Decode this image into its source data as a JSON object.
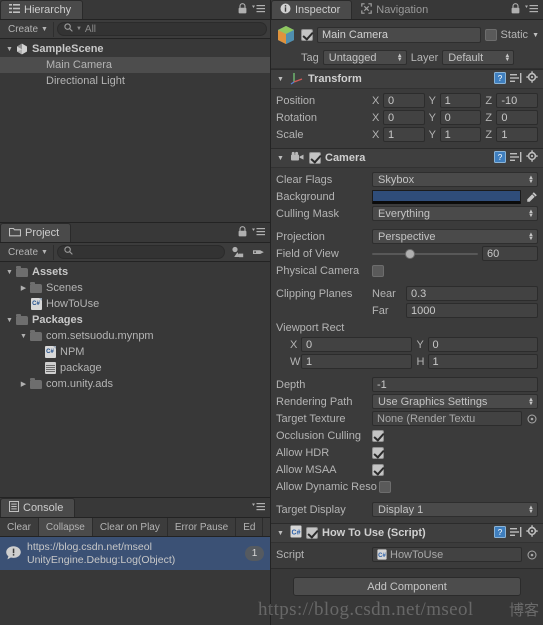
{
  "hierarchy": {
    "tab_label": "Hierarchy",
    "create_label": "Create",
    "search_placeholder": "All",
    "items": [
      {
        "label": "SampleScene",
        "indent": 0,
        "arrow": "down",
        "icon": "unity-scene-icon",
        "bold": true,
        "selected": false
      },
      {
        "label": "Main Camera",
        "indent": 1,
        "arrow": "none",
        "icon": "none",
        "bold": false,
        "selected": true
      },
      {
        "label": "Directional Light",
        "indent": 1,
        "arrow": "none",
        "icon": "none",
        "bold": false,
        "selected": false
      }
    ]
  },
  "project": {
    "tab_label": "Project",
    "create_label": "Create",
    "search_placeholder": "",
    "items": [
      {
        "label": "Assets",
        "indent": 0,
        "arrow": "down",
        "icon": "folder-icon",
        "bold": true
      },
      {
        "label": "Scenes",
        "indent": 1,
        "arrow": "right",
        "icon": "folder-icon",
        "bold": false
      },
      {
        "label": "HowToUse",
        "indent": 1,
        "arrow": "none",
        "icon": "csharp-icon",
        "bold": false
      },
      {
        "label": "Packages",
        "indent": 0,
        "arrow": "down",
        "icon": "folder-icon",
        "bold": true
      },
      {
        "label": "com.setsuodu.mynpm",
        "indent": 1,
        "arrow": "down",
        "icon": "folder-icon",
        "bold": false
      },
      {
        "label": "NPM",
        "indent": 2,
        "arrow": "none",
        "icon": "csharp-icon",
        "bold": false
      },
      {
        "label": "package",
        "indent": 2,
        "arrow": "none",
        "icon": "text-file-icon",
        "bold": false
      },
      {
        "label": "com.unity.ads",
        "indent": 1,
        "arrow": "right",
        "icon": "folder-icon",
        "bold": false
      }
    ]
  },
  "console": {
    "tab_label": "Console",
    "buttons": [
      {
        "label": "Clear",
        "pressed": false
      },
      {
        "label": "Collapse",
        "pressed": true
      },
      {
        "label": "Clear on Play",
        "pressed": false
      },
      {
        "label": "Error Pause",
        "pressed": false
      },
      {
        "label": "Ed",
        "pressed": false
      }
    ],
    "entries": [
      {
        "line1": "https://blog.csdn.net/mseol",
        "line2": "UnityEngine.Debug:Log(Object)",
        "count": "1",
        "selected": true
      }
    ]
  },
  "inspector": {
    "tabs": [
      {
        "label": "Inspector",
        "icon": "info-icon",
        "active": true
      },
      {
        "label": "Navigation",
        "icon": "navigation-icon",
        "active": false
      }
    ],
    "game_object": {
      "name": "Main Camera",
      "enabled": true,
      "static_label": "Static",
      "static_checked": false,
      "tag_label": "Tag",
      "tag_value": "Untagged",
      "layer_label": "Layer",
      "layer_value": "Default"
    },
    "transform": {
      "title": "Transform",
      "rows": [
        {
          "name": "Position",
          "x": "0",
          "y": "1",
          "z": "-10"
        },
        {
          "name": "Rotation",
          "x": "0",
          "y": "0",
          "z": "0"
        },
        {
          "name": "Scale",
          "x": "1",
          "y": "1",
          "z": "1"
        }
      ],
      "axis_labels": {
        "x": "X",
        "y": "Y",
        "z": "Z"
      }
    },
    "camera": {
      "title": "Camera",
      "enabled": true,
      "clear_flags_label": "Clear Flags",
      "clear_flags_value": "Skybox",
      "background_label": "Background",
      "background_color": "#2f4d7a",
      "culling_mask_label": "Culling Mask",
      "culling_mask_value": "Everything",
      "projection_label": "Projection",
      "projection_value": "Perspective",
      "fov_label": "Field of View",
      "fov_value": "60",
      "physical_camera_label": "Physical Camera",
      "physical_camera_checked": false,
      "clipping_label": "Clipping Planes",
      "near_label": "Near",
      "near_value": "0.3",
      "far_label": "Far",
      "far_value": "1000",
      "viewport_label": "Viewport Rect",
      "viewport_x_label": "X",
      "viewport_x": "0",
      "viewport_y_label": "Y",
      "viewport_y": "0",
      "viewport_w_label": "W",
      "viewport_w": "1",
      "viewport_h_label": "H",
      "viewport_h": "1",
      "depth_label": "Depth",
      "depth_value": "-1",
      "rendering_path_label": "Rendering Path",
      "rendering_path_value": "Use Graphics Settings",
      "target_texture_label": "Target Texture",
      "target_texture_value": "None (Render Textu",
      "occlusion_label": "Occlusion Culling",
      "occlusion_checked": true,
      "hdr_label": "Allow HDR",
      "hdr_checked": true,
      "msaa_label": "Allow MSAA",
      "msaa_checked": true,
      "dynamic_res_label": "Allow Dynamic Reso",
      "dynamic_res_checked": false,
      "target_display_label": "Target Display",
      "target_display_value": "Display 1"
    },
    "script_component": {
      "title": "How To Use (Script)",
      "enabled": true,
      "script_label": "Script",
      "script_value": "HowToUse"
    },
    "add_component_label": "Add Component"
  },
  "watermark": {
    "url": "https://blog.csdn.",
    "suffix": "net/mseol",
    "cn": "博客"
  }
}
